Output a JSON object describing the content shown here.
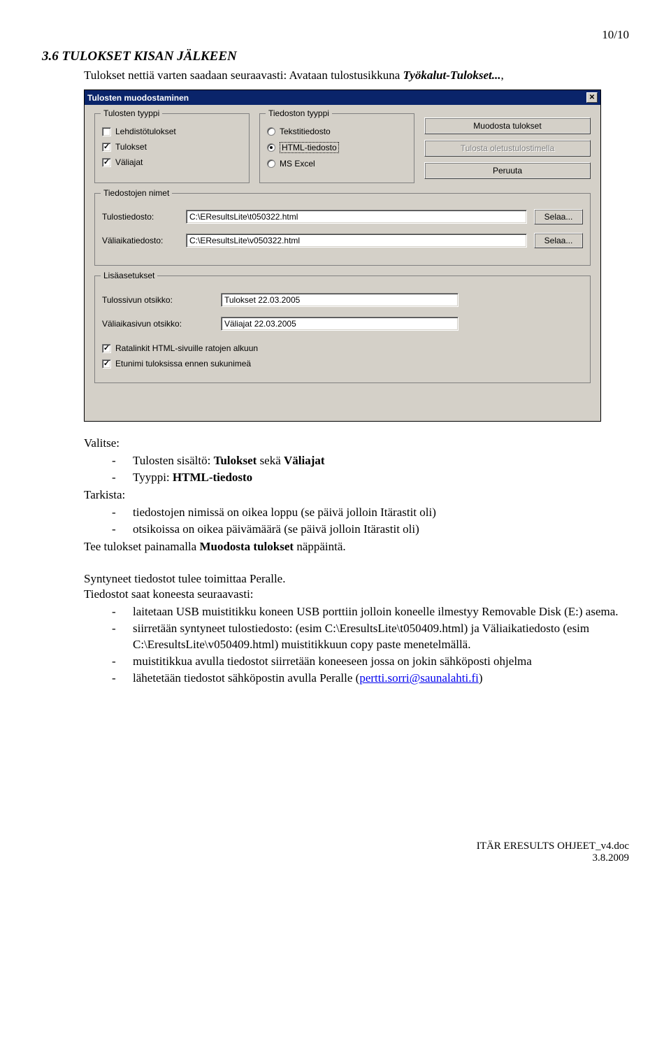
{
  "page_number": "10/10",
  "heading": "3.6  TULOKSET KISAN JÄLKEEN",
  "intro_before": "Tulokset nettiä varten saadaan seuraavasti: Avataan tulostusikkuna ",
  "intro_boldital": "Työkalut-Tulokset...",
  "intro_after": ",",
  "dialog": {
    "title": "Tulosten muodostaminen",
    "groups": {
      "tyyppi": {
        "legend": "Tulosten tyyppi",
        "opt1": "Lehdistötulokset",
        "opt2": "Tulokset",
        "opt3": "Väliajat"
      },
      "tiedosto": {
        "legend": "Tiedoston tyyppi",
        "opt1": "Tekstitiedosto",
        "opt2": "HTML-tiedosto",
        "opt3": "MS Excel"
      },
      "buttons": {
        "muodosta": "Muodosta tulokset",
        "tulosta": "Tulosta oletustulostimella",
        "peruuta": "Peruuta"
      },
      "nimet": {
        "legend": "Tiedostojen nimet",
        "tulos_label": "Tulostiedosto:",
        "tulos_value": "C:\\EResultsLite\\t050322.html",
        "vali_label": "Väliaikatiedosto:",
        "vali_value": "C:\\EResultsLite\\v050322.html",
        "selaa": "Selaa..."
      },
      "lisa": {
        "legend": "Lisäasetukset",
        "tulos_otsikko_label": "Tulossivun otsikko:",
        "tulos_otsikko_value": "Tulokset 22.03.2005",
        "vali_otsikko_label": "Väliaikasivun otsikko:",
        "vali_otsikko_value": "Väliajat 22.03.2005",
        "cb1": "Ratalinkit HTML-sivuille ratojen alkuun",
        "cb2": "Etunimi tuloksissa ennen sukunimeä"
      }
    }
  },
  "body": {
    "valitse": "Valitse:",
    "b1_pre": "Tulosten sisältö: ",
    "b1_bold1": "Tulokset",
    "b1_mid": " sekä ",
    "b1_bold2": "Väliajat",
    "b2_pre": "Tyyppi: ",
    "b2_bold": "HTML-tiedosto",
    "tarkista": "Tarkista:",
    "b3": "tiedostojen nimissä on oikea loppu (se päivä jolloin Itärastit oli)",
    "b4": "otsikoissa on oikea päivämäärä (se päivä jolloin Itärastit oli)",
    "tee_pre": "Tee tulokset painamalla ",
    "tee_bold": "Muodosta tulokset",
    "tee_post": " näppäintä.",
    "para2": "Syntyneet tiedostot tulee toimittaa Peralle.",
    "para3": "Tiedostot saat koneesta seuraavasti:",
    "s1": "laitetaan USB muistitikku koneen USB porttiin jolloin koneelle ilmestyy Removable Disk (E:) asema.",
    "s2": "siirretään syntyneet tulostiedosto: (esim C:\\EresultsLite\\t050409.html) ja Väliaikatiedosto (esim C:\\EresultsLite\\v050409.html) muistitikkuun copy paste menetelmällä.",
    "s3": "muistitikkua avulla tiedostot siirretään koneeseen jossa on jokin sähköposti ohjelma",
    "s4_pre": "lähetetään tiedostot sähköpostin avulla Peralle (",
    "s4_email": "pertti.sorri@saunalahti.fi",
    "s4_post": ")"
  },
  "footer": {
    "line1": "ITÄR ERESULTS OHJEET_v4.doc",
    "line2": "3.8.2009"
  }
}
